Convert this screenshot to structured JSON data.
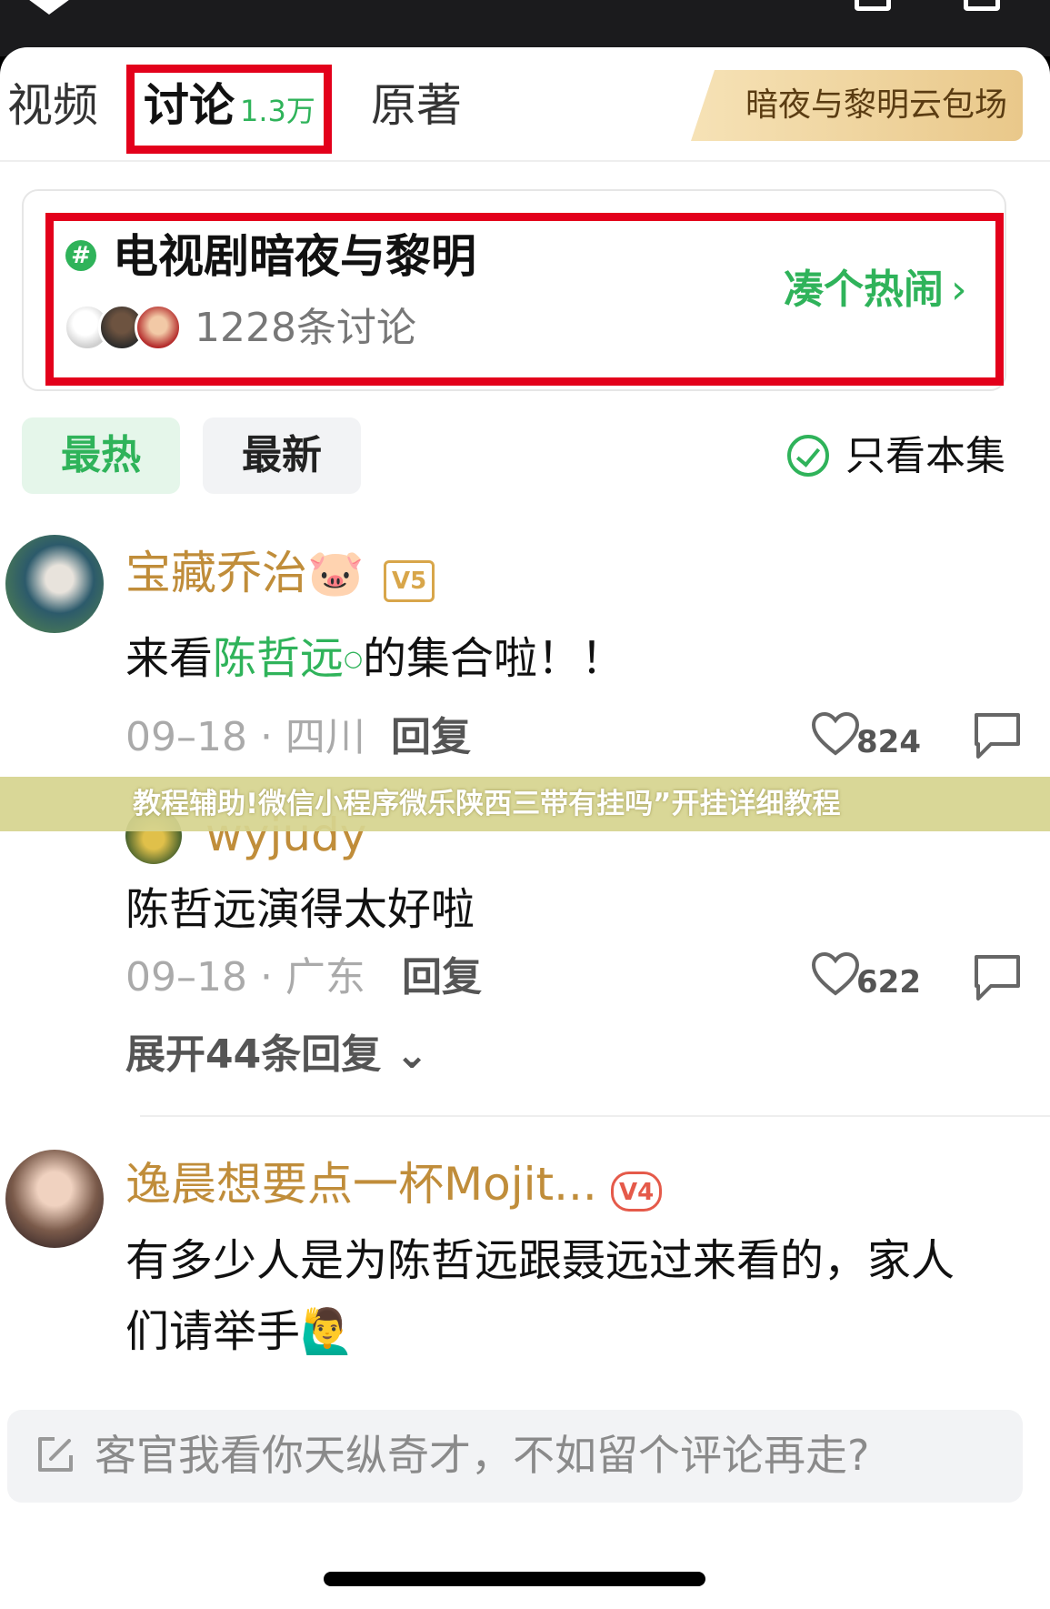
{
  "tabs": [
    {
      "label": "视频"
    },
    {
      "label": "讨论",
      "count": "1.3万",
      "active": true
    },
    {
      "label": "原著"
    }
  ],
  "promo": {
    "label": "暗夜与黎明云包场"
  },
  "topic": {
    "hash": "#",
    "title": "电视剧暗夜与黎明",
    "count": "1228条讨论",
    "join_label": "凑个热闹",
    "join_chevron": "›"
  },
  "filters": {
    "hot": "最热",
    "new": "最新",
    "only_episode": "只看本集"
  },
  "comments": [
    {
      "user": "宝藏乔治🐷",
      "badge": "V5",
      "text_before": "来看",
      "mention": "陈哲远",
      "text_after": "的集合啦！！",
      "date": "09–18 · 四川",
      "reply": "回复",
      "likes": "824"
    },
    {
      "user": "wyjudy",
      "text": "陈哲远演得太好啦",
      "date": "09–18 · 广东",
      "reply": "回复",
      "likes": "622",
      "expand": "展开44条回复",
      "expand_chevron": "⌄"
    },
    {
      "user": "逸晨想要点一杯Mojit...",
      "badge": "V4",
      "text_line1": "有多少人是为陈哲远跟聂远过来看的，家人",
      "text_line2": "们请举手🙋‍♂️"
    }
  ],
  "banner": {
    "text": "教程辅助!微信小程序微乐陕西三带有挂吗”开挂详细教程"
  },
  "input": {
    "placeholder": "客官我看你天纵奇才，不如留个评论再走?"
  },
  "colors": {
    "accent_green": "#2fb35a",
    "highlight_red": "#e3001b",
    "username_gold": "#c08d3a"
  }
}
